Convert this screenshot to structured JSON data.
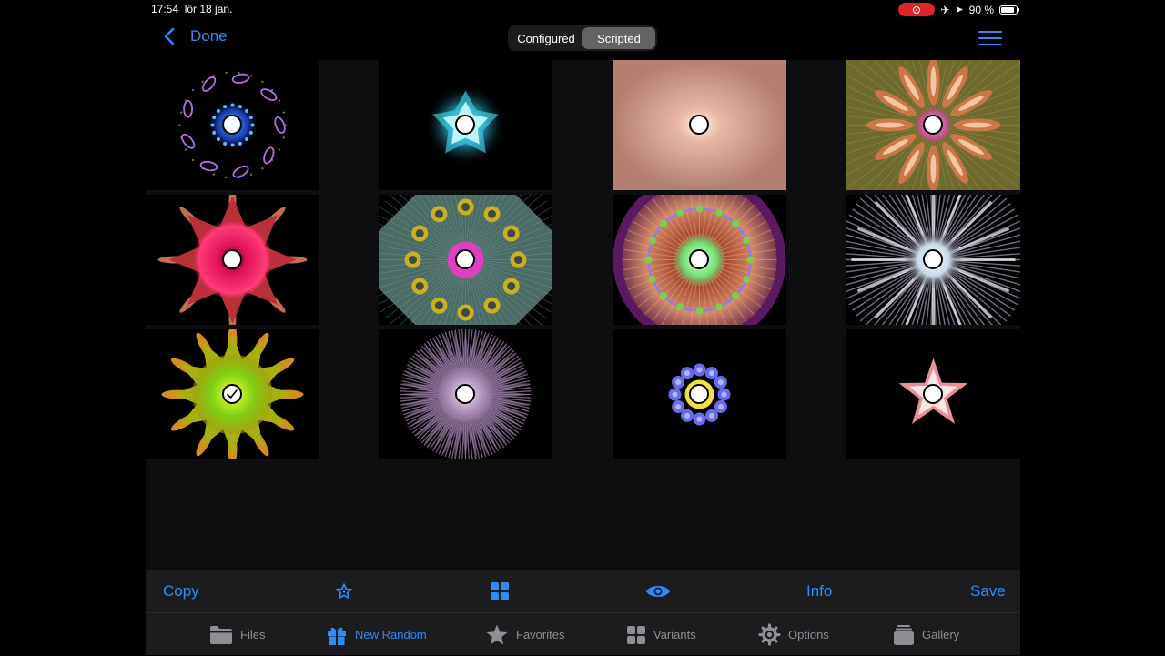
{
  "status_bar": {
    "time": "17:54",
    "date": "lör 18 jan.",
    "battery": "90 %"
  },
  "nav": {
    "back_label": "Done",
    "segments": [
      "Configured",
      "Scripted"
    ],
    "active_segment": "Scripted"
  },
  "toolbar": {
    "copy": "Copy",
    "info": "Info",
    "save": "Save"
  },
  "tabs": [
    {
      "label": "New Random",
      "icon": "gift-icon",
      "active": true
    },
    {
      "label": "Files",
      "icon": "folder-icon",
      "active": false
    },
    {
      "label": "Favorites",
      "icon": "star-icon",
      "active": false
    },
    {
      "label": "Variants",
      "icon": "grid-icon",
      "active": false
    },
    {
      "label": "Options",
      "icon": "gear-icon",
      "active": false
    },
    {
      "label": "Gallery",
      "icon": "stack-icon",
      "active": false
    }
  ],
  "colors": {
    "accent": "#2f8cf7",
    "background": "#000000",
    "toolbar": "#1c1c1e"
  },
  "fractal_tiles": [
    {
      "name": "purple-ellipse-ring",
      "selected": false
    },
    {
      "name": "cyan-star-glow",
      "selected": false
    },
    {
      "name": "peach-glow",
      "selected": false
    },
    {
      "name": "olive-feather-star",
      "selected": false
    },
    {
      "name": "pink-spiked-star",
      "selected": false
    },
    {
      "name": "teal-yellow-rings",
      "selected": false
    },
    {
      "name": "copper-mandala",
      "selected": false
    },
    {
      "name": "silver-burst",
      "selected": false
    },
    {
      "name": "yellow-green-star",
      "selected": true
    },
    {
      "name": "lavender-rays",
      "selected": false
    },
    {
      "name": "blue-flower",
      "selected": false
    },
    {
      "name": "pink-petal-star",
      "selected": false
    }
  ]
}
